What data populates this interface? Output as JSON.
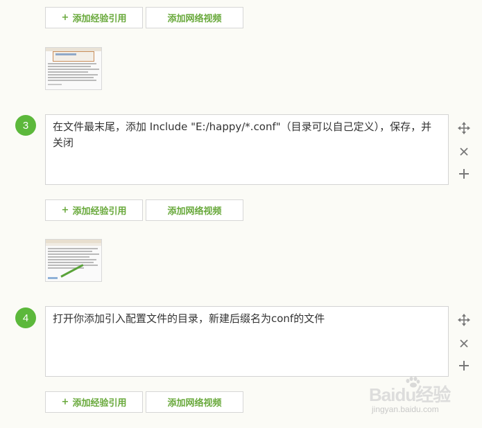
{
  "buttons": {
    "add_reference_icon": "+",
    "add_reference": "添加经验引用",
    "add_video": "添加网络视频"
  },
  "steps": [
    {
      "number": "3",
      "text": "在文件最末尾，添加 Include \"E:/happy/*.conf\"（目录可以自己定义），保存，并关闭"
    },
    {
      "number": "4",
      "text": "打开你添加引入配置文件的目录，新建后缀名为conf的文件"
    }
  ],
  "tools": {
    "move_icon": "move-icon",
    "delete_icon": "close-icon",
    "add_icon": "plus-icon"
  },
  "watermark": {
    "brand": "Baidu经验",
    "url": "jingyan.baidu.com"
  },
  "colors": {
    "accent_green": "#5cb83b",
    "button_text_green": "#69a93c",
    "background": "#fbfbf6"
  }
}
